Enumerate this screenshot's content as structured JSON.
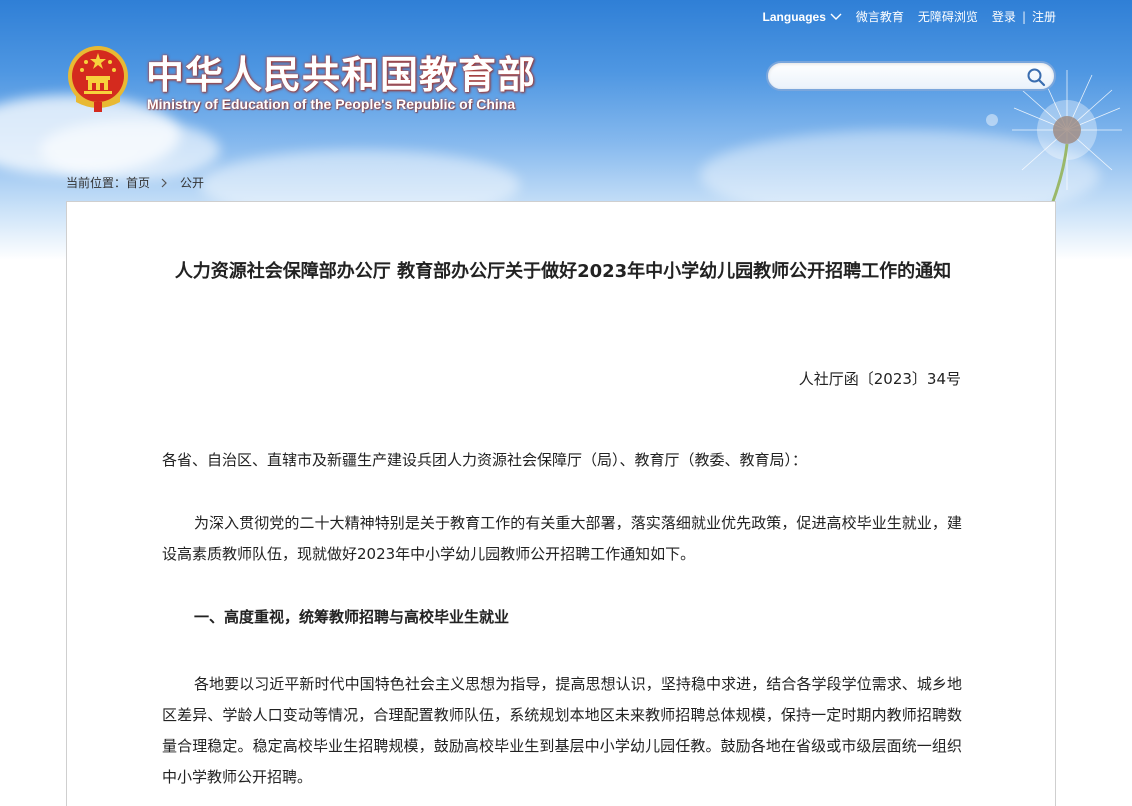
{
  "header": {
    "title_cn": "中华人民共和国教育部",
    "title_en": "Ministry of Education of the People's Republic of China",
    "emblem_icon": "national-emblem-icon"
  },
  "topnav": {
    "languages": "Languages",
    "weibo": "微言教育",
    "accessibility": "无障碍浏览",
    "login": "登录",
    "separator": "|",
    "register": "注册"
  },
  "search": {
    "placeholder": "",
    "icon": "search-icon"
  },
  "breadcrumb": {
    "prefix": "当前位置：",
    "home": "首页",
    "current": "公开"
  },
  "document": {
    "title": "人力资源社会保障部办公厅 教育部办公厅关于做好2023年中小学幼儿园教师公开招聘工作的通知",
    "number": "人社厅函〔2023〕34号",
    "addressee": "各省、自治区、直辖市及新疆生产建设兵团人力资源社会保障厅（局）、教育厅（教委、教育局）：",
    "para1": "为深入贯彻党的二十大精神特别是关于教育工作的有关重大部署，落实落细就业优先政策，促进高校毕业生就业，建设高素质教师队伍，现就做好2023年中小学幼儿园教师公开招聘工作通知如下。",
    "heading1": "一、高度重视，统筹教师招聘与高校毕业生就业",
    "para2": "各地要以习近平新时代中国特色社会主义思想为指导，提高思想认识，坚持稳中求进，结合各学段学位需求、城乡地区差异、学龄人口变动等情况，合理配置教师队伍，系统规划本地区未来教师招聘总体规模，保持一定时期内教师招聘数量合理稳定。稳定高校毕业生招聘规模，鼓励高校毕业生到基层中小学幼儿园任教。鼓励各地在省级或市级层面统一组织中小学教师公开招聘。"
  },
  "colors": {
    "sky_top": "#2f7fd6",
    "title_outline": "#c23a2a",
    "text": "#222222"
  }
}
